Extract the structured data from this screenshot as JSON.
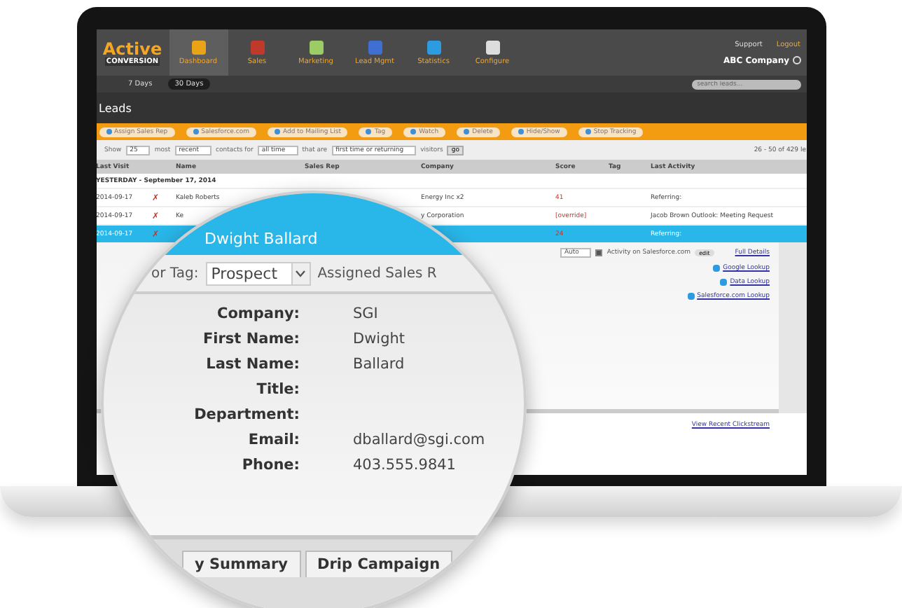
{
  "app": {
    "logo_top": "Active",
    "logo_bottom": "CONVERSION"
  },
  "nav": [
    {
      "label": "Dashboard",
      "selected": true,
      "color": "#e8a317"
    },
    {
      "label": "Sales",
      "selected": false,
      "color": "#c0392b"
    },
    {
      "label": "Marketing",
      "selected": false,
      "color": "#9ccc65"
    },
    {
      "label": "Lead Mgmt",
      "selected": false,
      "color": "#3f6fd1"
    },
    {
      "label": "Statistics",
      "selected": false,
      "color": "#2d9be0"
    },
    {
      "label": "Configure",
      "selected": false,
      "color": "#dddddd"
    }
  ],
  "user_links": [
    {
      "label": "Support",
      "kind": "plain"
    },
    {
      "label": "Logout",
      "kind": "accent"
    }
  ],
  "account": "ABC Company",
  "ranges": [
    {
      "label": "7 Days",
      "selected": false
    },
    {
      "label": "30 Days",
      "selected": true
    }
  ],
  "search": {
    "placeholder": "search leads..."
  },
  "page_title": "Leads",
  "actions": [
    "Assign Sales Rep",
    "Salesforce.com",
    "Add to Mailing List",
    "Tag",
    "Watch",
    "Delete",
    "Hide/Show",
    "Stop Tracking"
  ],
  "filter": [
    {
      "kind": "text",
      "text": "Show"
    },
    {
      "kind": "select",
      "text": "25"
    },
    {
      "kind": "text",
      "text": "most"
    },
    {
      "kind": "select",
      "text": "recent"
    },
    {
      "kind": "text",
      "text": "contacts for"
    },
    {
      "kind": "select",
      "text": "all time"
    },
    {
      "kind": "text",
      "text": "that are"
    },
    {
      "kind": "select",
      "text": "first time or returning"
    },
    {
      "kind": "text",
      "text": "visitors"
    },
    {
      "kind": "button",
      "text": "go"
    }
  ],
  "result_count": "26 - 50 of 429 le",
  "table": {
    "columns": [
      "Last Visit",
      "Name",
      "Sales Rep",
      "Company",
      "Score",
      "Tag",
      "Last Activity"
    ],
    "group": "YESTERDAY - September 17, 2014",
    "rows": [
      {
        "last_visit": "2014-09-17",
        "flag": "✗",
        "name": "Kaleb Roberts",
        "company": "Energy Inc x2",
        "score": "41",
        "last_activity": "Referring:",
        "selected": false
      },
      {
        "last_visit": "2014-09-17",
        "flag": "✗",
        "name": "Ke",
        "company": "y Corporation",
        "score": "[override]",
        "last_activity": "Jacob Brown Outlook: Meeting Request",
        "selected": false
      },
      {
        "last_visit": "2014-09-17",
        "flag": "✗",
        "score": "24",
        "last_activity": "Referring:",
        "selected": true
      }
    ]
  },
  "details": {
    "mode": "Auto",
    "sync_label": "Activity on Salesforce.com",
    "sync_checked": true,
    "edit": "edit",
    "full_details": "Full Details",
    "lookups": [
      "Google Lookup",
      "Data Lookup",
      "Salesforce.com Lookup"
    ],
    "clickstream": "View Recent Clickstream"
  },
  "magnifier": {
    "lead_name": "Dwight Ballard",
    "tag_label": "or Tag:",
    "tag_value": "Prospect",
    "rep_label": "Assigned Sales R",
    "fields": [
      {
        "label": "Company:",
        "value": "SGI"
      },
      {
        "label": "First Name:",
        "value": "Dwight"
      },
      {
        "label": "Last Name:",
        "value": "Ballard"
      },
      {
        "label": "Title:"
      },
      {
        "label": "Department:"
      },
      {
        "label": "Email:",
        "value": "dballard@sgi.com"
      },
      {
        "label": "Phone:",
        "value": "403.555.9841"
      }
    ],
    "tabs": [
      "y Summary",
      "Drip Campaign"
    ]
  }
}
